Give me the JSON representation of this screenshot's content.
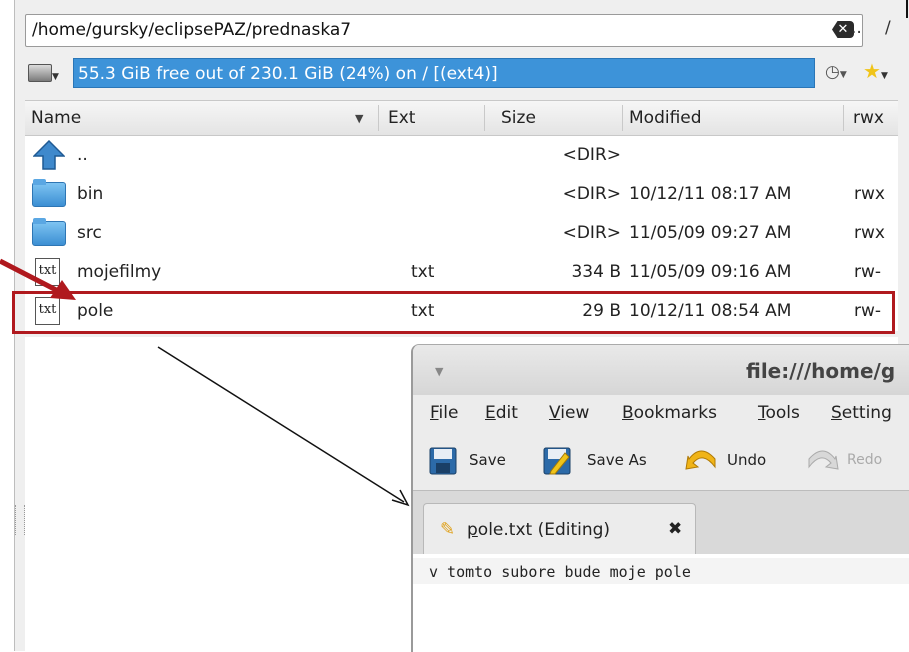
{
  "file_manager": {
    "path": "/home/gursky/eclipsePAZ/prednaska7",
    "nav_up": "..",
    "nav_root": "/",
    "free_space": "55.3 GiB free out of 230.1 GiB (24%) on / [(ext4)]",
    "columns": {
      "name": "Name",
      "sort_marker": "▼",
      "ext": "Ext",
      "size": "Size",
      "modified": "Modified",
      "rwx": "rwx"
    },
    "rows": [
      {
        "icon": "up-arrow-icon",
        "name": "..",
        "ext": "",
        "size": "<DIR>",
        "modified": "",
        "rwx": ""
      },
      {
        "icon": "folder-icon",
        "name": "bin",
        "ext": "",
        "size": "<DIR>",
        "modified": "10/12/11 08:17 AM",
        "rwx": "rwx"
      },
      {
        "icon": "folder-icon",
        "name": "src",
        "ext": "",
        "size": "<DIR>",
        "modified": "11/05/09 09:27 AM",
        "rwx": "rwx"
      },
      {
        "icon": "txt-file-icon",
        "name": "mojefilmy",
        "ext": "txt",
        "size": "334 B",
        "modified": "11/05/09 09:16 AM",
        "rwx": "rw-"
      },
      {
        "icon": "txt-file-icon",
        "name": "pole",
        "ext": "txt",
        "size": "29 B",
        "modified": "10/12/11 08:54 AM",
        "rwx": "rw-"
      }
    ],
    "txt_icon_label": "txt",
    "selection_color": "#3d93d9",
    "highlight_color": "#b0191e"
  },
  "editor": {
    "title": "file:///home/g",
    "menu": [
      {
        "label": "File",
        "key": "F",
        "rest": "ile"
      },
      {
        "label": "Edit",
        "key": "E",
        "rest": "dit"
      },
      {
        "label": "View",
        "key": "V",
        "rest": "iew"
      },
      {
        "label": "Bookmarks",
        "key": "B",
        "rest": "ookmarks"
      },
      {
        "label": "Tools",
        "key": "T",
        "rest": "ools"
      },
      {
        "label": "Setting",
        "key": "S",
        "rest": "etting"
      }
    ],
    "toolbar": {
      "save": "Save",
      "save_as": "Save As",
      "undo": "Undo",
      "redo": "Redo"
    },
    "tab": {
      "label_key": "p",
      "label_rest": "ole.txt (Editing)"
    },
    "content": "v tomto subore bude moje pole"
  }
}
